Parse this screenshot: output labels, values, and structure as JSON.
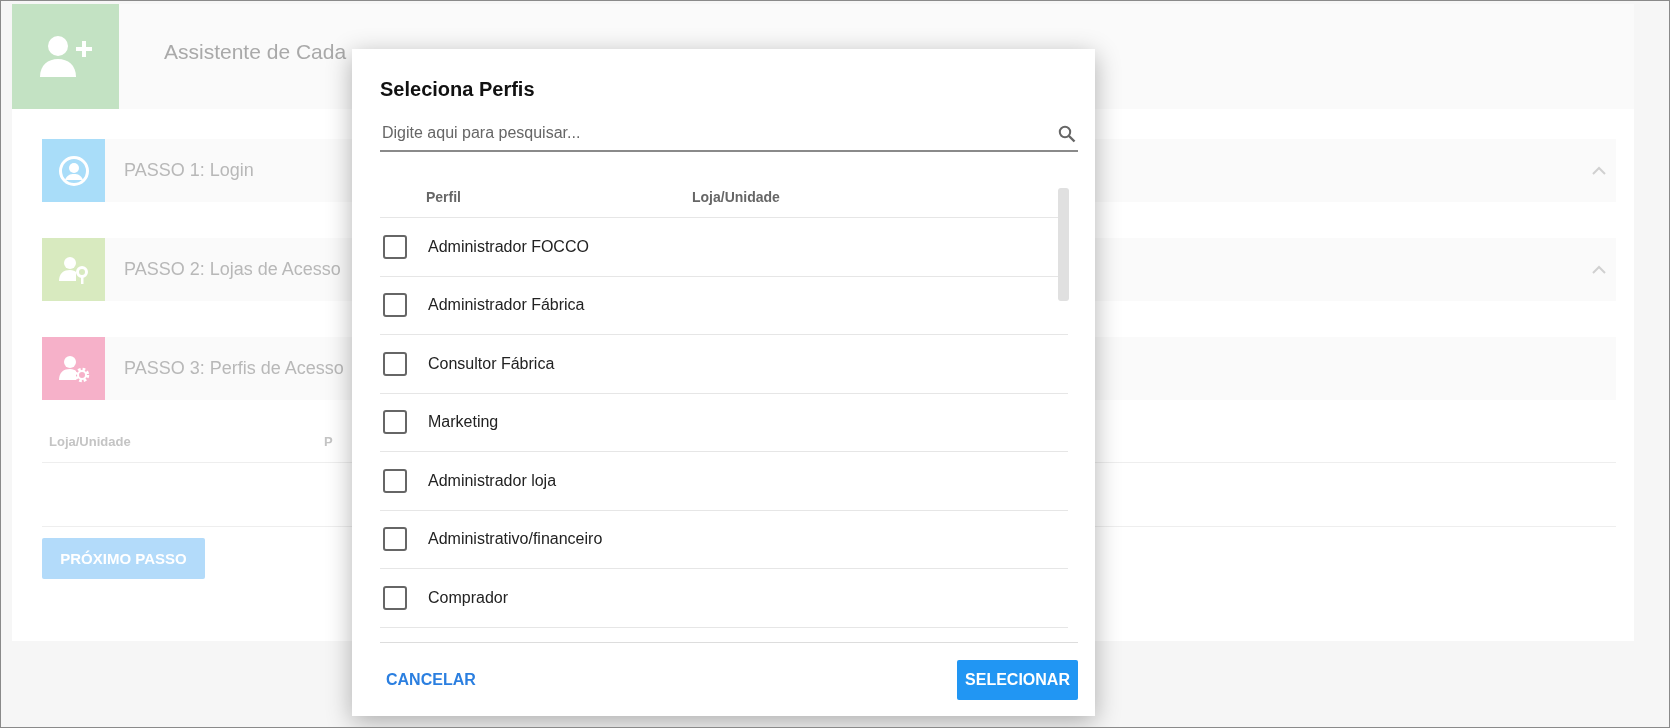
{
  "page": {
    "title": "Assistente de Cada",
    "steps": [
      {
        "label": "PASSO 1: Login",
        "kind": "login",
        "color": "#a9ddf9",
        "completed": true
      },
      {
        "label": "PASSO 2: Lojas de Acesso",
        "kind": "key",
        "color": "#d8eabf",
        "completed": true
      },
      {
        "label": "PASSO 3: Perfis de Acesso",
        "kind": "gear",
        "color": "#f6b1c9",
        "completed": false
      }
    ],
    "table": {
      "columns": [
        "Loja/Unidade",
        "P"
      ]
    },
    "next_button": {
      "label": "PRÓXIMO PASSO",
      "disabled": true
    }
  },
  "dialog": {
    "title": "Seleciona Perfis",
    "search": {
      "placeholder": "Digite aqui para pesquisar..."
    },
    "columns": [
      "Perfil",
      "Loja/Unidade"
    ],
    "rows": [
      {
        "perfil": "Administrador FOCCO",
        "checked": false
      },
      {
        "perfil": "Administrador Fábrica",
        "checked": false
      },
      {
        "perfil": "Consultor Fábrica",
        "checked": false
      },
      {
        "perfil": "Marketing",
        "checked": false
      },
      {
        "perfil": "Administrador loja",
        "checked": false
      },
      {
        "perfil": "Administrativo/financeiro",
        "checked": false
      },
      {
        "perfil": "Comprador",
        "checked": false
      }
    ],
    "cancel": "CANCELAR",
    "confirm": "SELECIONAR"
  }
}
